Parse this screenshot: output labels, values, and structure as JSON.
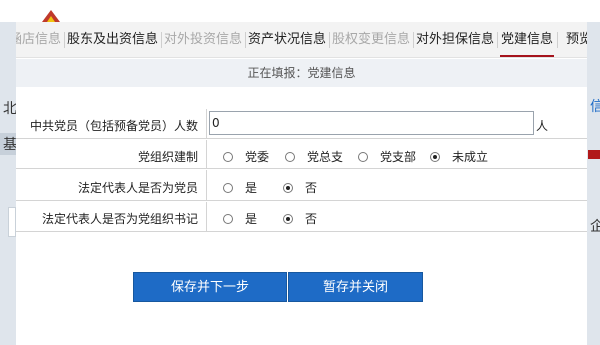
{
  "background": {
    "left_chars": [
      "北",
      "基"
    ],
    "right_chars": [
      "信",
      "企"
    ]
  },
  "tabs": [
    {
      "label": "涵店信息",
      "state": "disabled"
    },
    {
      "label": "股东及出资信息",
      "state": "normal"
    },
    {
      "label": "对外投资信息",
      "state": "disabled"
    },
    {
      "label": "资产状况信息",
      "state": "normal"
    },
    {
      "label": "股权变更信息",
      "state": "disabled"
    },
    {
      "label": "对外担保信息",
      "state": "normal"
    },
    {
      "label": "党建信息",
      "state": "active"
    },
    {
      "label": "预览",
      "state": "normal"
    }
  ],
  "status": "正在填报：党建信息",
  "form": {
    "party_members": {
      "label": "中共党员（包括预备党员）人数",
      "value": "0",
      "unit": "人"
    },
    "org_system": {
      "label": "党组织建制",
      "options": [
        "党委",
        "党总支",
        "党支部",
        "未成立"
      ],
      "selected": "未成立"
    },
    "rep_is_member": {
      "label": "法定代表人是否为党员",
      "options": [
        "是",
        "否"
      ],
      "selected": "否"
    },
    "rep_is_secretary": {
      "label": "法定代表人是否为党组织书记",
      "options": [
        "是",
        "否"
      ],
      "selected": "否"
    }
  },
  "buttons": {
    "save_next": "保存并下一步",
    "save_close": "暂存并关闭"
  },
  "colors": {
    "primary_button": "#1e6bc6",
    "active_tab_underline": "#a5131c"
  }
}
